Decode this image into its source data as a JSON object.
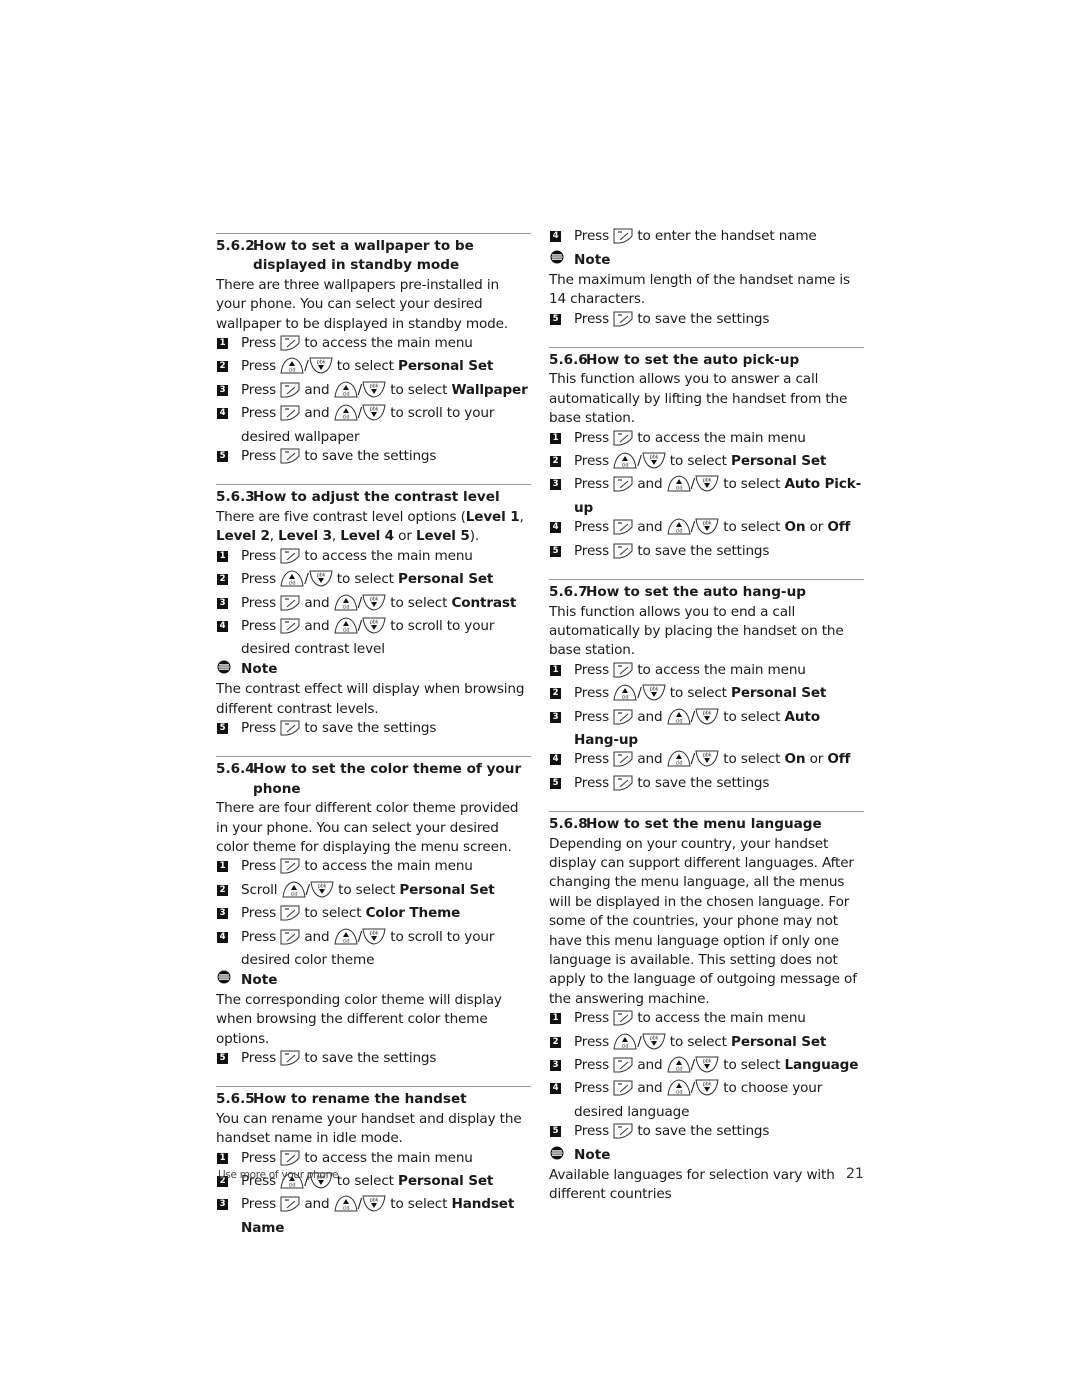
{
  "sections_left": [
    {
      "number": "5.6.2",
      "title": "How to set a wallpaper to be displayed in standby mode",
      "intro": "There are three wallpapers pre-installed in your phone.  You can select your desired wallpaper to be displayed in standby mode.",
      "steps": [
        {
          "n": "1",
          "parts": [
            [
              "t",
              "Press "
            ],
            [
              "menu-key-icon"
            ],
            [
              "t",
              " to access the main menu"
            ]
          ]
        },
        {
          "n": "2",
          "parts": [
            [
              "t",
              "Press "
            ],
            [
              "up-key-icon"
            ],
            [
              "t",
              "/"
            ],
            [
              "down-key-icon"
            ],
            [
              "t",
              " to select "
            ],
            [
              "b",
              "Personal Set"
            ]
          ]
        },
        {
          "n": "3",
          "parts": [
            [
              "t",
              "Press "
            ],
            [
              "menu-key-icon"
            ],
            [
              "t",
              " and "
            ],
            [
              "up-key-icon"
            ],
            [
              "t",
              "/"
            ],
            [
              "down-key-icon"
            ],
            [
              "t",
              " to select "
            ],
            [
              "b",
              "Wallpaper"
            ]
          ]
        },
        {
          "n": "4",
          "parts": [
            [
              "t",
              "Press "
            ],
            [
              "menu-key-icon"
            ],
            [
              "t",
              " and "
            ],
            [
              "up-key-icon"
            ],
            [
              "t",
              "/"
            ],
            [
              "down-key-icon"
            ],
            [
              "t",
              " to scroll to your desired wallpaper"
            ]
          ]
        },
        {
          "n": "5",
          "parts": [
            [
              "t",
              "Press "
            ],
            [
              "menu-key-icon"
            ],
            [
              "t",
              " to save the settings"
            ]
          ]
        }
      ]
    },
    {
      "number": "5.6.3",
      "title": "How to adjust the contrast level",
      "intro_parts": [
        [
          "t",
          "There are five contrast level options ("
        ],
        [
          "b",
          "Level 1"
        ],
        [
          "t",
          ", "
        ],
        [
          "b",
          "Level 2"
        ],
        [
          "t",
          ", "
        ],
        [
          "b",
          "Level 3"
        ],
        [
          "t",
          ", "
        ],
        [
          "b",
          "Level 4"
        ],
        [
          "t",
          " or "
        ],
        [
          "b",
          "Level 5"
        ],
        [
          "t",
          ")."
        ]
      ],
      "steps": [
        {
          "n": "1",
          "parts": [
            [
              "t",
              "Press "
            ],
            [
              "menu-key-icon"
            ],
            [
              "t",
              " to access the main menu"
            ]
          ]
        },
        {
          "n": "2",
          "parts": [
            [
              "t",
              "Press "
            ],
            [
              "up-key-icon"
            ],
            [
              "t",
              "/"
            ],
            [
              "down-key-icon"
            ],
            [
              "t",
              " to select "
            ],
            [
              "b",
              "Personal Set"
            ]
          ]
        },
        {
          "n": "3",
          "parts": [
            [
              "t",
              "Press "
            ],
            [
              "menu-key-icon"
            ],
            [
              "t",
              " and "
            ],
            [
              "up-key-icon"
            ],
            [
              "t",
              "/"
            ],
            [
              "down-key-icon"
            ],
            [
              "t",
              " to select "
            ],
            [
              "b",
              "Contrast"
            ]
          ]
        },
        {
          "n": "4",
          "parts": [
            [
              "t",
              "Press "
            ],
            [
              "menu-key-icon"
            ],
            [
              "t",
              " and "
            ],
            [
              "up-key-icon"
            ],
            [
              "t",
              "/"
            ],
            [
              "down-key-icon"
            ],
            [
              "t",
              " to scroll to your desired contrast level"
            ]
          ]
        },
        {
          "note": "Note",
          "text": "The contrast effect will display when browsing different contrast levels."
        },
        {
          "n": "5",
          "parts": [
            [
              "t",
              "Press "
            ],
            [
              "menu-key-icon"
            ],
            [
              "t",
              " to save the settings"
            ]
          ]
        }
      ]
    },
    {
      "number": "5.6.4",
      "title": "How to set the color theme of your phone",
      "intro": "There are four different color theme provided in your phone.  You can select your desired color theme for displaying the menu screen.",
      "steps": [
        {
          "n": "1",
          "parts": [
            [
              "t",
              "Press "
            ],
            [
              "menu-key-icon"
            ],
            [
              "t",
              " to access the main menu"
            ]
          ]
        },
        {
          "n": "2",
          "parts": [
            [
              "t",
              "Scroll "
            ],
            [
              "up-key-icon"
            ],
            [
              "t",
              "/"
            ],
            [
              "down-key-icon"
            ],
            [
              "t",
              " to select "
            ],
            [
              "b",
              "Personal Set"
            ]
          ]
        },
        {
          "n": "3",
          "parts": [
            [
              "t",
              "Press "
            ],
            [
              "menu-key-icon"
            ],
            [
              "t",
              " to select "
            ],
            [
              "b",
              "Color Theme"
            ]
          ]
        },
        {
          "n": "4",
          "parts": [
            [
              "t",
              "Press "
            ],
            [
              "menu-key-icon"
            ],
            [
              "t",
              " and "
            ],
            [
              "up-key-icon"
            ],
            [
              "t",
              "/"
            ],
            [
              "down-key-icon"
            ],
            [
              "t",
              " to scroll to your desired color theme"
            ]
          ]
        },
        {
          "note": "Note",
          "text": "The corresponding color theme will display when browsing the different color theme options."
        },
        {
          "n": "5",
          "parts": [
            [
              "t",
              "Press "
            ],
            [
              "menu-key-icon"
            ],
            [
              "t",
              " to save the settings"
            ]
          ]
        }
      ]
    },
    {
      "number": "5.6.5",
      "title": "How to rename the handset",
      "intro": "You can rename your handset and display the handset name in idle mode.",
      "steps": [
        {
          "n": "1",
          "parts": [
            [
              "t",
              "Press "
            ],
            [
              "menu-key-icon"
            ],
            [
              "t",
              " to access the main menu"
            ]
          ]
        },
        {
          "n": "2",
          "parts": [
            [
              "t",
              "Press "
            ],
            [
              "up-key-icon"
            ],
            [
              "t",
              "/"
            ],
            [
              "down-key-icon"
            ],
            [
              "t",
              " to select "
            ],
            [
              "b",
              "Personal Set"
            ]
          ]
        },
        {
          "n": "3",
          "parts": [
            [
              "t",
              "Press "
            ],
            [
              "menu-key-icon"
            ],
            [
              "t",
              " and "
            ],
            [
              "up-key-icon"
            ],
            [
              "t",
              "/"
            ],
            [
              "down-key-icon"
            ],
            [
              "t",
              " to select "
            ],
            [
              "b",
              "Handset Name"
            ]
          ]
        }
      ]
    }
  ],
  "sections_right": [
    {
      "continued": true,
      "steps": [
        {
          "n": "4",
          "parts": [
            [
              "t",
              "Press "
            ],
            [
              "menu-key-icon"
            ],
            [
              "t",
              " to enter the handset name"
            ]
          ]
        },
        {
          "note": "Note",
          "text": "The maximum length of the handset name is 14 characters."
        },
        {
          "n": "5",
          "parts": [
            [
              "t",
              "Press "
            ],
            [
              "menu-key-icon"
            ],
            [
              "t",
              " to save the settings"
            ]
          ]
        }
      ]
    },
    {
      "number": "5.6.6",
      "title": "How to set the auto pick-up",
      "intro": "This function allows you to answer a call automatically by lifting the handset from the base station.",
      "steps": [
        {
          "n": "1",
          "parts": [
            [
              "t",
              "Press "
            ],
            [
              "menu-key-icon"
            ],
            [
              "t",
              " to access the main menu"
            ]
          ]
        },
        {
          "n": "2",
          "parts": [
            [
              "t",
              "Press "
            ],
            [
              "up-key-icon"
            ],
            [
              "t",
              "/"
            ],
            [
              "down-key-icon"
            ],
            [
              "t",
              " to select "
            ],
            [
              "b",
              "Personal Set"
            ]
          ]
        },
        {
          "n": "3",
          "parts": [
            [
              "t",
              "Press "
            ],
            [
              "menu-key-icon"
            ],
            [
              "t",
              " and "
            ],
            [
              "up-key-icon"
            ],
            [
              "t",
              "/"
            ],
            [
              "down-key-icon"
            ],
            [
              "t",
              " to select "
            ],
            [
              "b",
              "Auto Pick-up"
            ]
          ]
        },
        {
          "n": "4",
          "parts": [
            [
              "t",
              "Press "
            ],
            [
              "menu-key-icon"
            ],
            [
              "t",
              " and "
            ],
            [
              "up-key-icon"
            ],
            [
              "t",
              "/"
            ],
            [
              "down-key-icon"
            ],
            [
              "t",
              " to select "
            ],
            [
              "b",
              "On"
            ],
            [
              "t",
              " or "
            ],
            [
              "b",
              "Off"
            ]
          ]
        },
        {
          "n": "5",
          "parts": [
            [
              "t",
              "Press "
            ],
            [
              "menu-key-icon"
            ],
            [
              "t",
              " to save the settings"
            ]
          ]
        }
      ]
    },
    {
      "number": "5.6.7",
      "title": "How to set the auto hang-up",
      "intro": "This function allows you to end a call automatically by placing the handset on the base station.",
      "steps": [
        {
          "n": "1",
          "parts": [
            [
              "t",
              "Press "
            ],
            [
              "menu-key-icon"
            ],
            [
              "t",
              " to access the main menu"
            ]
          ]
        },
        {
          "n": "2",
          "parts": [
            [
              "t",
              "Press "
            ],
            [
              "up-key-icon"
            ],
            [
              "t",
              "/"
            ],
            [
              "down-key-icon"
            ],
            [
              "t",
              " to select "
            ],
            [
              "b",
              "Personal Set"
            ]
          ]
        },
        {
          "n": "3",
          "parts": [
            [
              "t",
              "Press "
            ],
            [
              "menu-key-icon"
            ],
            [
              "t",
              " and "
            ],
            [
              "up-key-icon"
            ],
            [
              "t",
              "/"
            ],
            [
              "down-key-icon"
            ],
            [
              "t",
              " to select "
            ],
            [
              "b",
              "Auto Hang-up"
            ]
          ]
        },
        {
          "n": "4",
          "parts": [
            [
              "t",
              "Press "
            ],
            [
              "menu-key-icon"
            ],
            [
              "t",
              " and "
            ],
            [
              "up-key-icon"
            ],
            [
              "t",
              "/"
            ],
            [
              "down-key-icon"
            ],
            [
              "t",
              " to select "
            ],
            [
              "b",
              "On"
            ],
            [
              "t",
              " or "
            ],
            [
              "b",
              "Off"
            ]
          ]
        },
        {
          "n": "5",
          "parts": [
            [
              "t",
              "Press "
            ],
            [
              "menu-key-icon"
            ],
            [
              "t",
              " to save the settings"
            ]
          ]
        }
      ]
    },
    {
      "number": "5.6.8",
      "title": "How to set the menu language",
      "intro": "Depending on your country, your handset display can support different languages. After changing the menu language, all the menus will be displayed in the chosen language.  For some of the countries, your phone may not have this menu language option if only one language is available. This setting does not apply to the language of outgoing message of the answering machine.",
      "steps": [
        {
          "n": "1",
          "parts": [
            [
              "t",
              "Press "
            ],
            [
              "menu-key-icon"
            ],
            [
              "t",
              " to access the main menu"
            ]
          ]
        },
        {
          "n": "2",
          "parts": [
            [
              "t",
              "Press "
            ],
            [
              "up-key-icon"
            ],
            [
              "t",
              "/"
            ],
            [
              "down-key-icon"
            ],
            [
              "t",
              " to select "
            ],
            [
              "b",
              "Personal Set"
            ]
          ]
        },
        {
          "n": "3",
          "parts": [
            [
              "t",
              "Press "
            ],
            [
              "menu-key-icon"
            ],
            [
              "t",
              " and "
            ],
            [
              "up-key-icon"
            ],
            [
              "t",
              "/"
            ],
            [
              "down-key-icon"
            ],
            [
              "t",
              " to select "
            ],
            [
              "b",
              "Language"
            ]
          ]
        },
        {
          "n": "4",
          "parts": [
            [
              "t",
              "Press "
            ],
            [
              "menu-key-icon"
            ],
            [
              "t",
              " and "
            ],
            [
              "up-key-icon"
            ],
            [
              "t",
              "/"
            ],
            [
              "down-key-icon"
            ],
            [
              "t",
              " to choose your desired language"
            ]
          ]
        },
        {
          "n": "5",
          "parts": [
            [
              "t",
              "Press "
            ],
            [
              "menu-key-icon"
            ],
            [
              "t",
              " to save the settings"
            ]
          ]
        },
        {
          "note": "Note",
          "text": "Available languages for selection vary with different countries"
        }
      ]
    }
  ],
  "icon_labels": {
    "up": "cid",
    "down": "pbk"
  },
  "footer": {
    "chapter": "Use more of your phone",
    "page_number": "21"
  }
}
